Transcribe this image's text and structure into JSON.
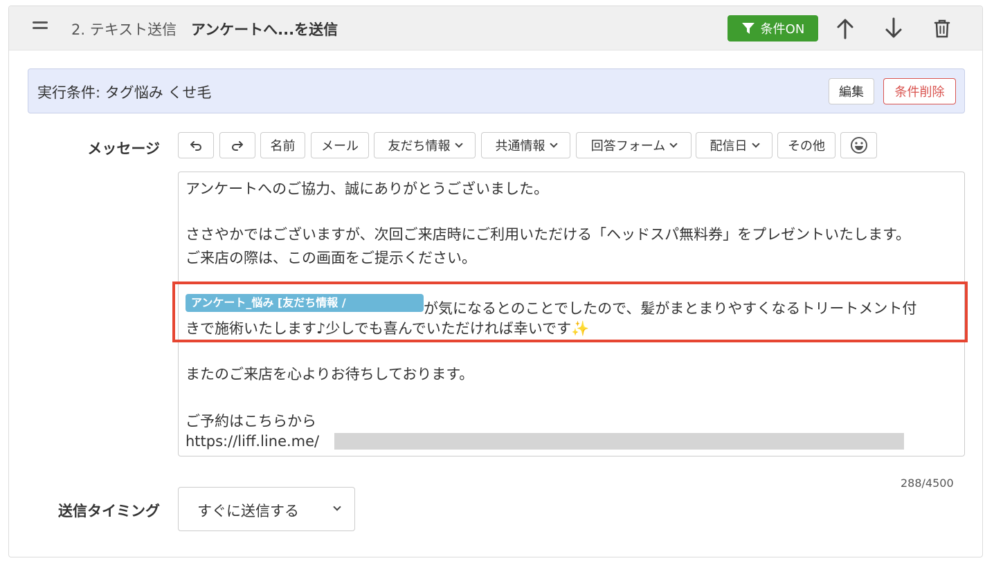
{
  "header": {
    "step_label": "2. テキスト送信",
    "step_title": "アンケートへ...を送信",
    "condition_toggle": "条件ON"
  },
  "condition": {
    "text": "実行条件: タグ悩み くせ毛",
    "edit_label": "編集",
    "delete_label": "条件削除"
  },
  "message": {
    "label": "メッセージ",
    "toolbar": {
      "name": "名前",
      "mail": "メール",
      "friend_info": "友だち情報",
      "common_info": "共通情報",
      "answer_form": "回答フォーム",
      "send_date": "配信日",
      "other": "その他"
    },
    "body": {
      "line1": "アンケートへのご協力、誠にありがとうございました。",
      "line2": "ささやかではございますが、次回ご来店時にご利用いただける「ヘッドスパ無料券」をプレゼントいたします。",
      "line3": "ご来店の際は、この画面をご提示ください。",
      "tag_chip": "アンケート_悩み [友だち情報 /",
      "line4a": "が気になるとのことでしたので、髪がまとまりやすくなるトリートメント付",
      "line4b": "きで施術いたします♪少しでも喜んでいただければ幸いです✨",
      "line5": "またのご来店を心よりお待ちしております。",
      "line6": "ご予約はこちらから",
      "line7": "https://liff.line.me/"
    },
    "counter": "288/4500"
  },
  "timing": {
    "label": "送信タイミング",
    "value": "すぐに送信する"
  },
  "colors": {
    "condition_on": "#3f9d2f",
    "condition_bar": "#e6ebfb",
    "delete": "#d9534f",
    "tag_chip": "#6ab7d8",
    "highlight": "#e64632"
  }
}
